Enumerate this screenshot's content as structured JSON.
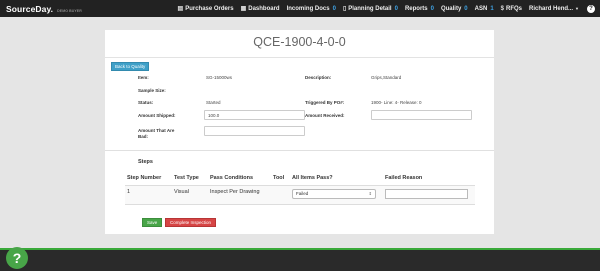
{
  "nav": {
    "brand": "SourceDay.",
    "brand_sub": "DEMO BUYER",
    "items": [
      {
        "label": "Purchase Orders",
        "icon": "books-icon",
        "badge": ""
      },
      {
        "label": "Dashboard",
        "icon": "dashboard-icon",
        "badge": ""
      },
      {
        "label": "Incoming Docs",
        "icon": "",
        "badge": "0"
      },
      {
        "label": "Planning Detail",
        "icon": "file-icon",
        "badge": "0"
      },
      {
        "label": "Reports",
        "icon": "",
        "badge": "0"
      },
      {
        "label": "Quality",
        "icon": "",
        "badge": "0"
      },
      {
        "label": "ASN",
        "icon": "",
        "badge": "1"
      },
      {
        "label": "RFQs",
        "icon": "dollar-icon",
        "badge": ""
      }
    ],
    "user": "Richard Hend...",
    "help": "?"
  },
  "page": {
    "title": "QCE-1900-4-0-0",
    "back_label": "Back to Quality"
  },
  "details": {
    "item_label": "Item:",
    "item_value": "SG-15000ws",
    "description_label": "Description:",
    "description_value": "Grips,Standard",
    "sample_size_label": "Sample Size:",
    "status_label": "Status:",
    "status_value": "Started",
    "triggered_label": "Triggered By PO#:",
    "triggered_value": "1900- Line: 4- Release: 0",
    "amount_shipped_label": "Amount Shipped:",
    "amount_shipped_value": "100.0",
    "amount_received_label": "Amount Received:",
    "amount_received_value": "",
    "amount_bad_label": "Amount That Are Bad:",
    "amount_bad_value": ""
  },
  "steps": {
    "title": "Steps",
    "headers": [
      "Step Number",
      "Test Type",
      "Pass Conditions",
      "Tool",
      "All Items Pass?",
      "Failed Reason"
    ],
    "rows": [
      {
        "step": "1",
        "test_type": "Visual",
        "pass_conditions": "Inspect Per Drawing",
        "tool": "",
        "all_pass": "Failed",
        "failed_reason": ""
      }
    ]
  },
  "actions": {
    "save": "Save",
    "complete": "Complete Inspection"
  },
  "footer": {
    "help": "?"
  },
  "colors": {
    "nav_bg": "#222222",
    "badge": "#3fa3e4",
    "save": "#48a548",
    "complete": "#d64545",
    "back": "#3fa0c8",
    "footer_accent": "#3aa93a"
  }
}
